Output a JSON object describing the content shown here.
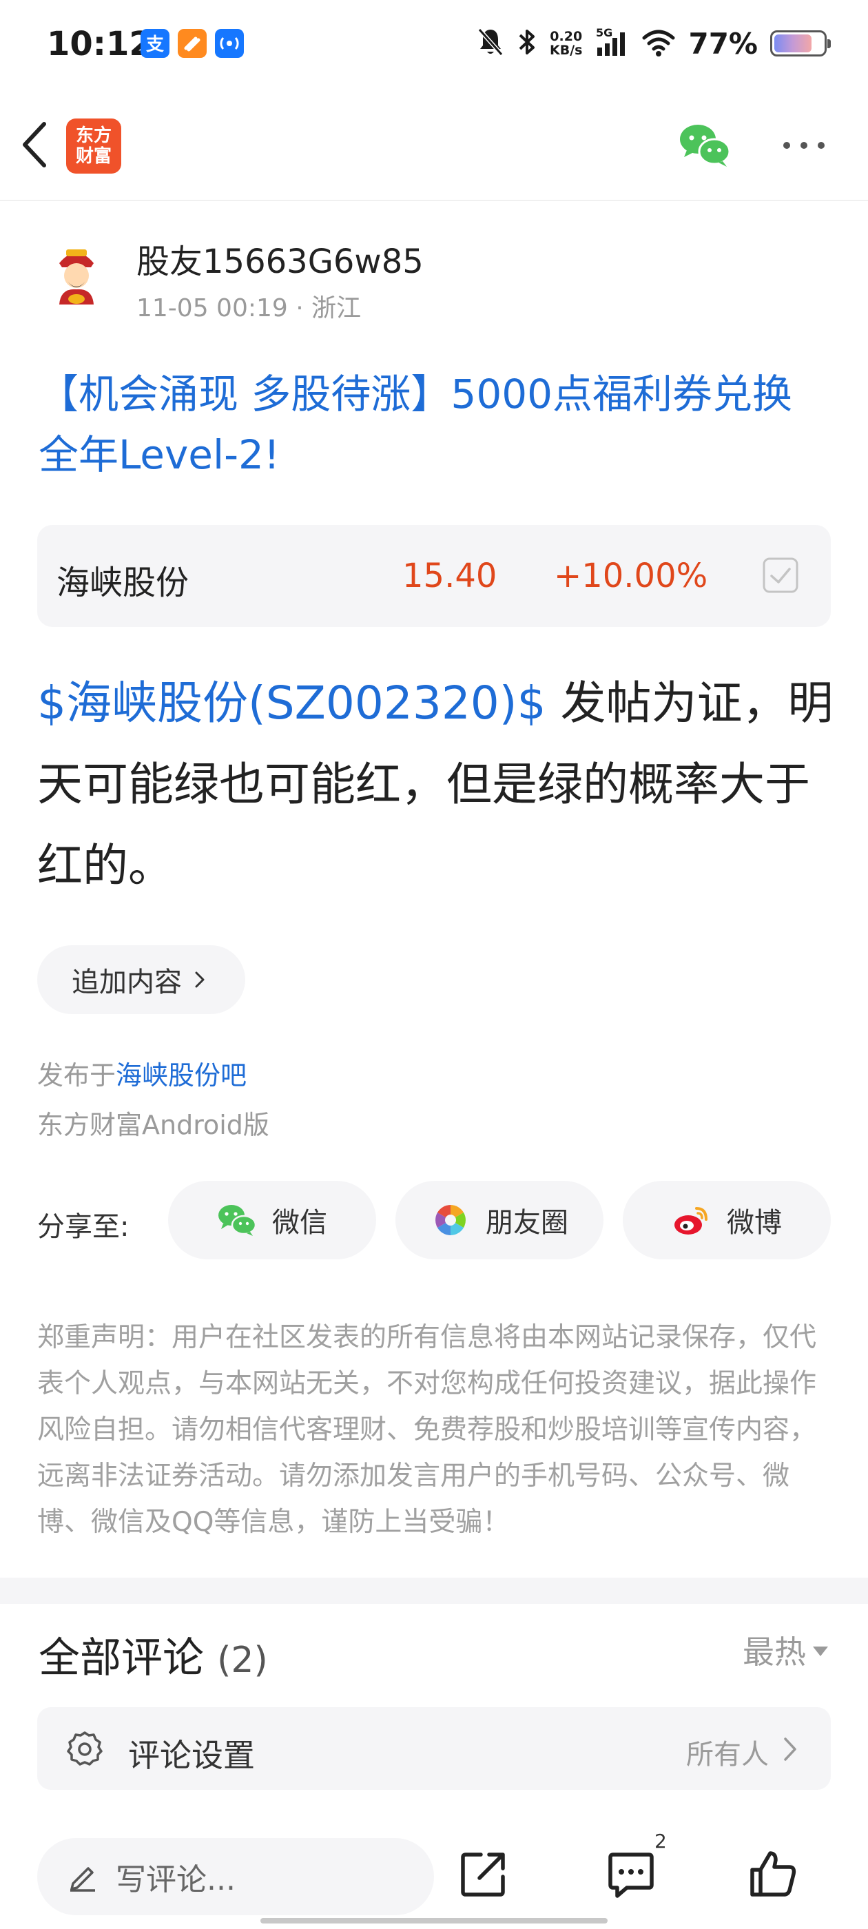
{
  "status_bar": {
    "time": "10:12",
    "net_speed_value": "0.20",
    "net_speed_unit": "KB/s",
    "network": "5G",
    "battery": "77%",
    "battery_level": 0.77
  },
  "nav": {
    "logo_line1": "东方",
    "logo_line2": "财富"
  },
  "author": {
    "name": "股友15663G6w85",
    "meta": "11-05 00:19 · 浙江"
  },
  "post": {
    "title": "【机会涌现 多股待涨】5000点福利券兑换全年Level-2!",
    "stock_link": "$海峡股份(SZ002320)$",
    "body": " 发帖为证，明天可能绿也可能红，但是绿的概率大于红的。"
  },
  "stock_card": {
    "name": "海峡股份",
    "price": "15.40",
    "change": "+10.00%"
  },
  "append": {
    "label": "追加内容"
  },
  "publish": {
    "prefix": "发布于",
    "forum": "海峡股份吧",
    "client": "东方财富Android版"
  },
  "share": {
    "label": "分享至:",
    "wechat": "微信",
    "moments": "朋友圈",
    "weibo": "微博"
  },
  "disclaimer": "郑重声明：用户在社区发表的所有信息将由本网站记录保存，仅代表个人观点，与本网站无关，不对您构成任何投资建议，据此操作风险自担。请勿相信代客理财、免费荐股和炒股培训等宣传内容，远离非法证券活动。请勿添加发言用户的手机号码、公众号、微博、微信及QQ等信息，谨防上当受骗！",
  "comments": {
    "title": "全部评论",
    "count": "(2)",
    "sort": "最热",
    "settings_label": "评论设置",
    "settings_value": "所有人"
  },
  "bottom_bar": {
    "placeholder": "写评论...",
    "comment_badge": "2"
  },
  "colors": {
    "link_blue": "#1e6cd6",
    "up_red": "#e0471b",
    "logo_orange": "#f0522a"
  }
}
